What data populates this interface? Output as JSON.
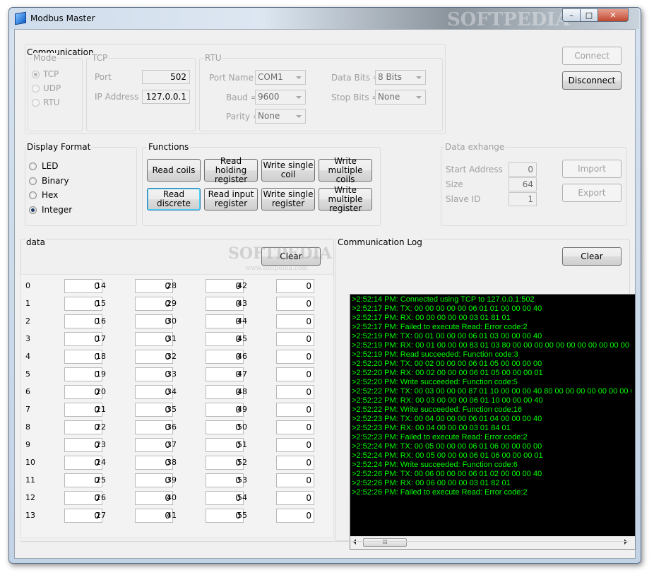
{
  "window": {
    "title": "Modbus Master",
    "controls": {
      "minimize": "–",
      "maximize": "□",
      "close": "✕"
    }
  },
  "watermark": {
    "brand": "SOFTPEDIA",
    "url": "www.softpedia.com"
  },
  "communication": {
    "title": "Communication",
    "mode": {
      "title": "Mode",
      "options": [
        "TCP",
        "UDP",
        "RTU"
      ],
      "selected": "TCP"
    },
    "tcp": {
      "title": "TCP",
      "port_label": "Port",
      "port_value": "502",
      "ip_label": "IP Address",
      "ip_value": "127.0.0.1"
    },
    "rtu": {
      "title": "RTU",
      "port_name_label": "Port Name =",
      "port_name_value": "COM1",
      "baud_label": "Baud =",
      "baud_value": "9600",
      "parity_label": "Parity =",
      "parity_value": "None",
      "data_bits_label": "Data Bits =",
      "data_bits_value": "8 Bits",
      "stop_bits_label": "Stop Bits =",
      "stop_bits_value": "None"
    },
    "connect_label": "Connect",
    "disconnect_label": "Disconnect"
  },
  "display_format": {
    "title": "Display Format",
    "options": [
      "LED",
      "Binary",
      "Hex",
      "Integer"
    ],
    "selected": "Integer"
  },
  "functions": {
    "title": "Functions",
    "read_coils": "Read coils",
    "read_holding_register": "Read holding register",
    "write_single_coil": "Write single coil",
    "write_multiple_coils": "Write multiple coils",
    "read_discrete": "Read discrete",
    "read_input_register": "Read input register",
    "write_single_register": "Write single register",
    "write_multiple_register": "Write multiple register"
  },
  "data_exchange": {
    "title": "Data exhange",
    "start_address_label": "Start Address",
    "start_address_value": "0",
    "size_label": "Size",
    "size_value": "64",
    "slave_id_label": "Slave ID",
    "slave_id_value": "1",
    "import_label": "Import",
    "export_label": "Export"
  },
  "data": {
    "title": "data",
    "clear_label": "Clear",
    "columns": [
      {
        "labels": [
          "0",
          "1",
          "2",
          "3",
          "4",
          "5",
          "6",
          "7",
          "8",
          "9",
          "10",
          "11",
          "12",
          "13"
        ],
        "values": [
          "0",
          "0",
          "0",
          "0",
          "0",
          "0",
          "0",
          "0",
          "0",
          "0",
          "0",
          "0",
          "0",
          "0"
        ]
      },
      {
        "labels": [
          "14",
          "15",
          "16",
          "17",
          "18",
          "19",
          "20",
          "21",
          "22",
          "23",
          "24",
          "25",
          "26",
          "27"
        ],
        "values": [
          "0",
          "0",
          "0",
          "0",
          "0",
          "0",
          "0",
          "0",
          "0",
          "0",
          "0",
          "0",
          "0",
          "0"
        ]
      },
      {
        "labels": [
          "28",
          "29",
          "30",
          "31",
          "32",
          "33",
          "34",
          "35",
          "36",
          "37",
          "38",
          "39",
          "40",
          "41"
        ],
        "values": [
          "0",
          "0",
          "0",
          "0",
          "0",
          "0",
          "0",
          "0",
          "0",
          "0",
          "0",
          "0",
          "0",
          "0"
        ]
      },
      {
        "labels": [
          "42",
          "43",
          "44",
          "45",
          "46",
          "47",
          "48",
          "49",
          "50",
          "51",
          "52",
          "53",
          "54",
          "55"
        ],
        "values": [
          "0",
          "0",
          "0",
          "0",
          "0",
          "0",
          "0",
          "0",
          "0",
          "0",
          "0",
          "0",
          "0",
          "0"
        ]
      }
    ]
  },
  "log": {
    "title": "Communication Log",
    "clear_label": "Clear",
    "scroll_thumb": "III",
    "lines": [
      ">2:52:14 PM: Connected using TCP to 127.0.0.1:502",
      ">2:52:17 PM: TX: 00 00 00 00 00 06 01 01 00 00 00 40",
      ">2:52:17 PM: RX: 00 00 00 00 00 03 01 81 01",
      ">2:52:17 PM: Failed to execute Read: Error code:2",
      ">2:52:19 PM: TX: 00 01 00 00 00 06 01 03 00 00 00 40",
      ">2:52:19 PM: RX: 00 01 00 00 00 83 01 03 80 00 00 00 00 00 00 00 00 00 00 00 00 00 00 00",
      ">2:52:19 PM: Read succeeded: Function code:3",
      ">2:52:20 PM: TX: 00 02 00 00 00 06 01 05 00 00 00 00",
      ">2:52:20 PM: RX: 00 02 00 00 00 06 01 05 00 00 00 01",
      ">2:52:20 PM: Write succeeded: Function code:5",
      ">2:52:22 PM: TX: 00 03 00 00 00 87 01 10 00 00 00 40 80 00 00 00 00 00 00 00 00 00 00",
      ">2:52:22 PM: RX: 00 03 00 00 00 06 01 10 00 00 00 40",
      ">2:52:22 PM: Write succeeded: Function code:16",
      ">2:52:23 PM: TX: 00 04 00 00 00 06 01 04 00 00 00 40",
      ">2:52:23 PM: RX: 00 04 00 00 00 03 01 84 01",
      ">2:52:23 PM: Failed to execute Read: Error code:2",
      ">2:52:24 PM: TX: 00 05 00 00 00 06 01 06 00 00 00 00",
      ">2:52:24 PM: RX: 00 05 00 00 00 06 01 06 00 00 00 01",
      ">2:52:24 PM: Write succeeded: Function code:6",
      ">2:52:26 PM: TX: 00 06 00 00 00 06 01 02 00 00 00 40",
      ">2:52:26 PM: RX: 00 06 00 00 00 03 01 82 01",
      ">2:52:26 PM: Failed to execute Read: Error code:2"
    ]
  },
  "colors": {
    "log_text": "#00ff00",
    "log_background": "#000000"
  }
}
